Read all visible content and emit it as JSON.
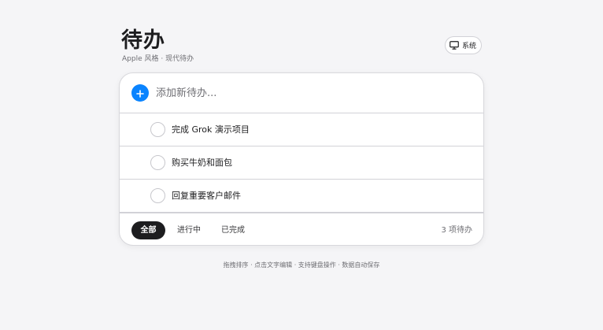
{
  "header": {
    "title": "待办",
    "subtitle": "Apple 风格 · 现代待办",
    "theme_label": "系统"
  },
  "add": {
    "placeholder": "添加新待办..."
  },
  "todos": [
    {
      "text": "完成 Grok 演示项目",
      "done": false
    },
    {
      "text": "购买牛奶和面包",
      "done": false
    },
    {
      "text": "回复重要客户邮件",
      "done": false
    }
  ],
  "filters": [
    {
      "label": "全部",
      "active": true
    },
    {
      "label": "进行中",
      "active": false
    },
    {
      "label": "已完成",
      "active": false
    }
  ],
  "count_text": "3 项待办",
  "hint": "拖拽排序 · 点击文字编辑 · 支持键盘操作 · 数据自动保存",
  "colors": {
    "accent": "#0a84ff",
    "background": "#f5f5f7",
    "active_filter": "#1d1d1f"
  }
}
